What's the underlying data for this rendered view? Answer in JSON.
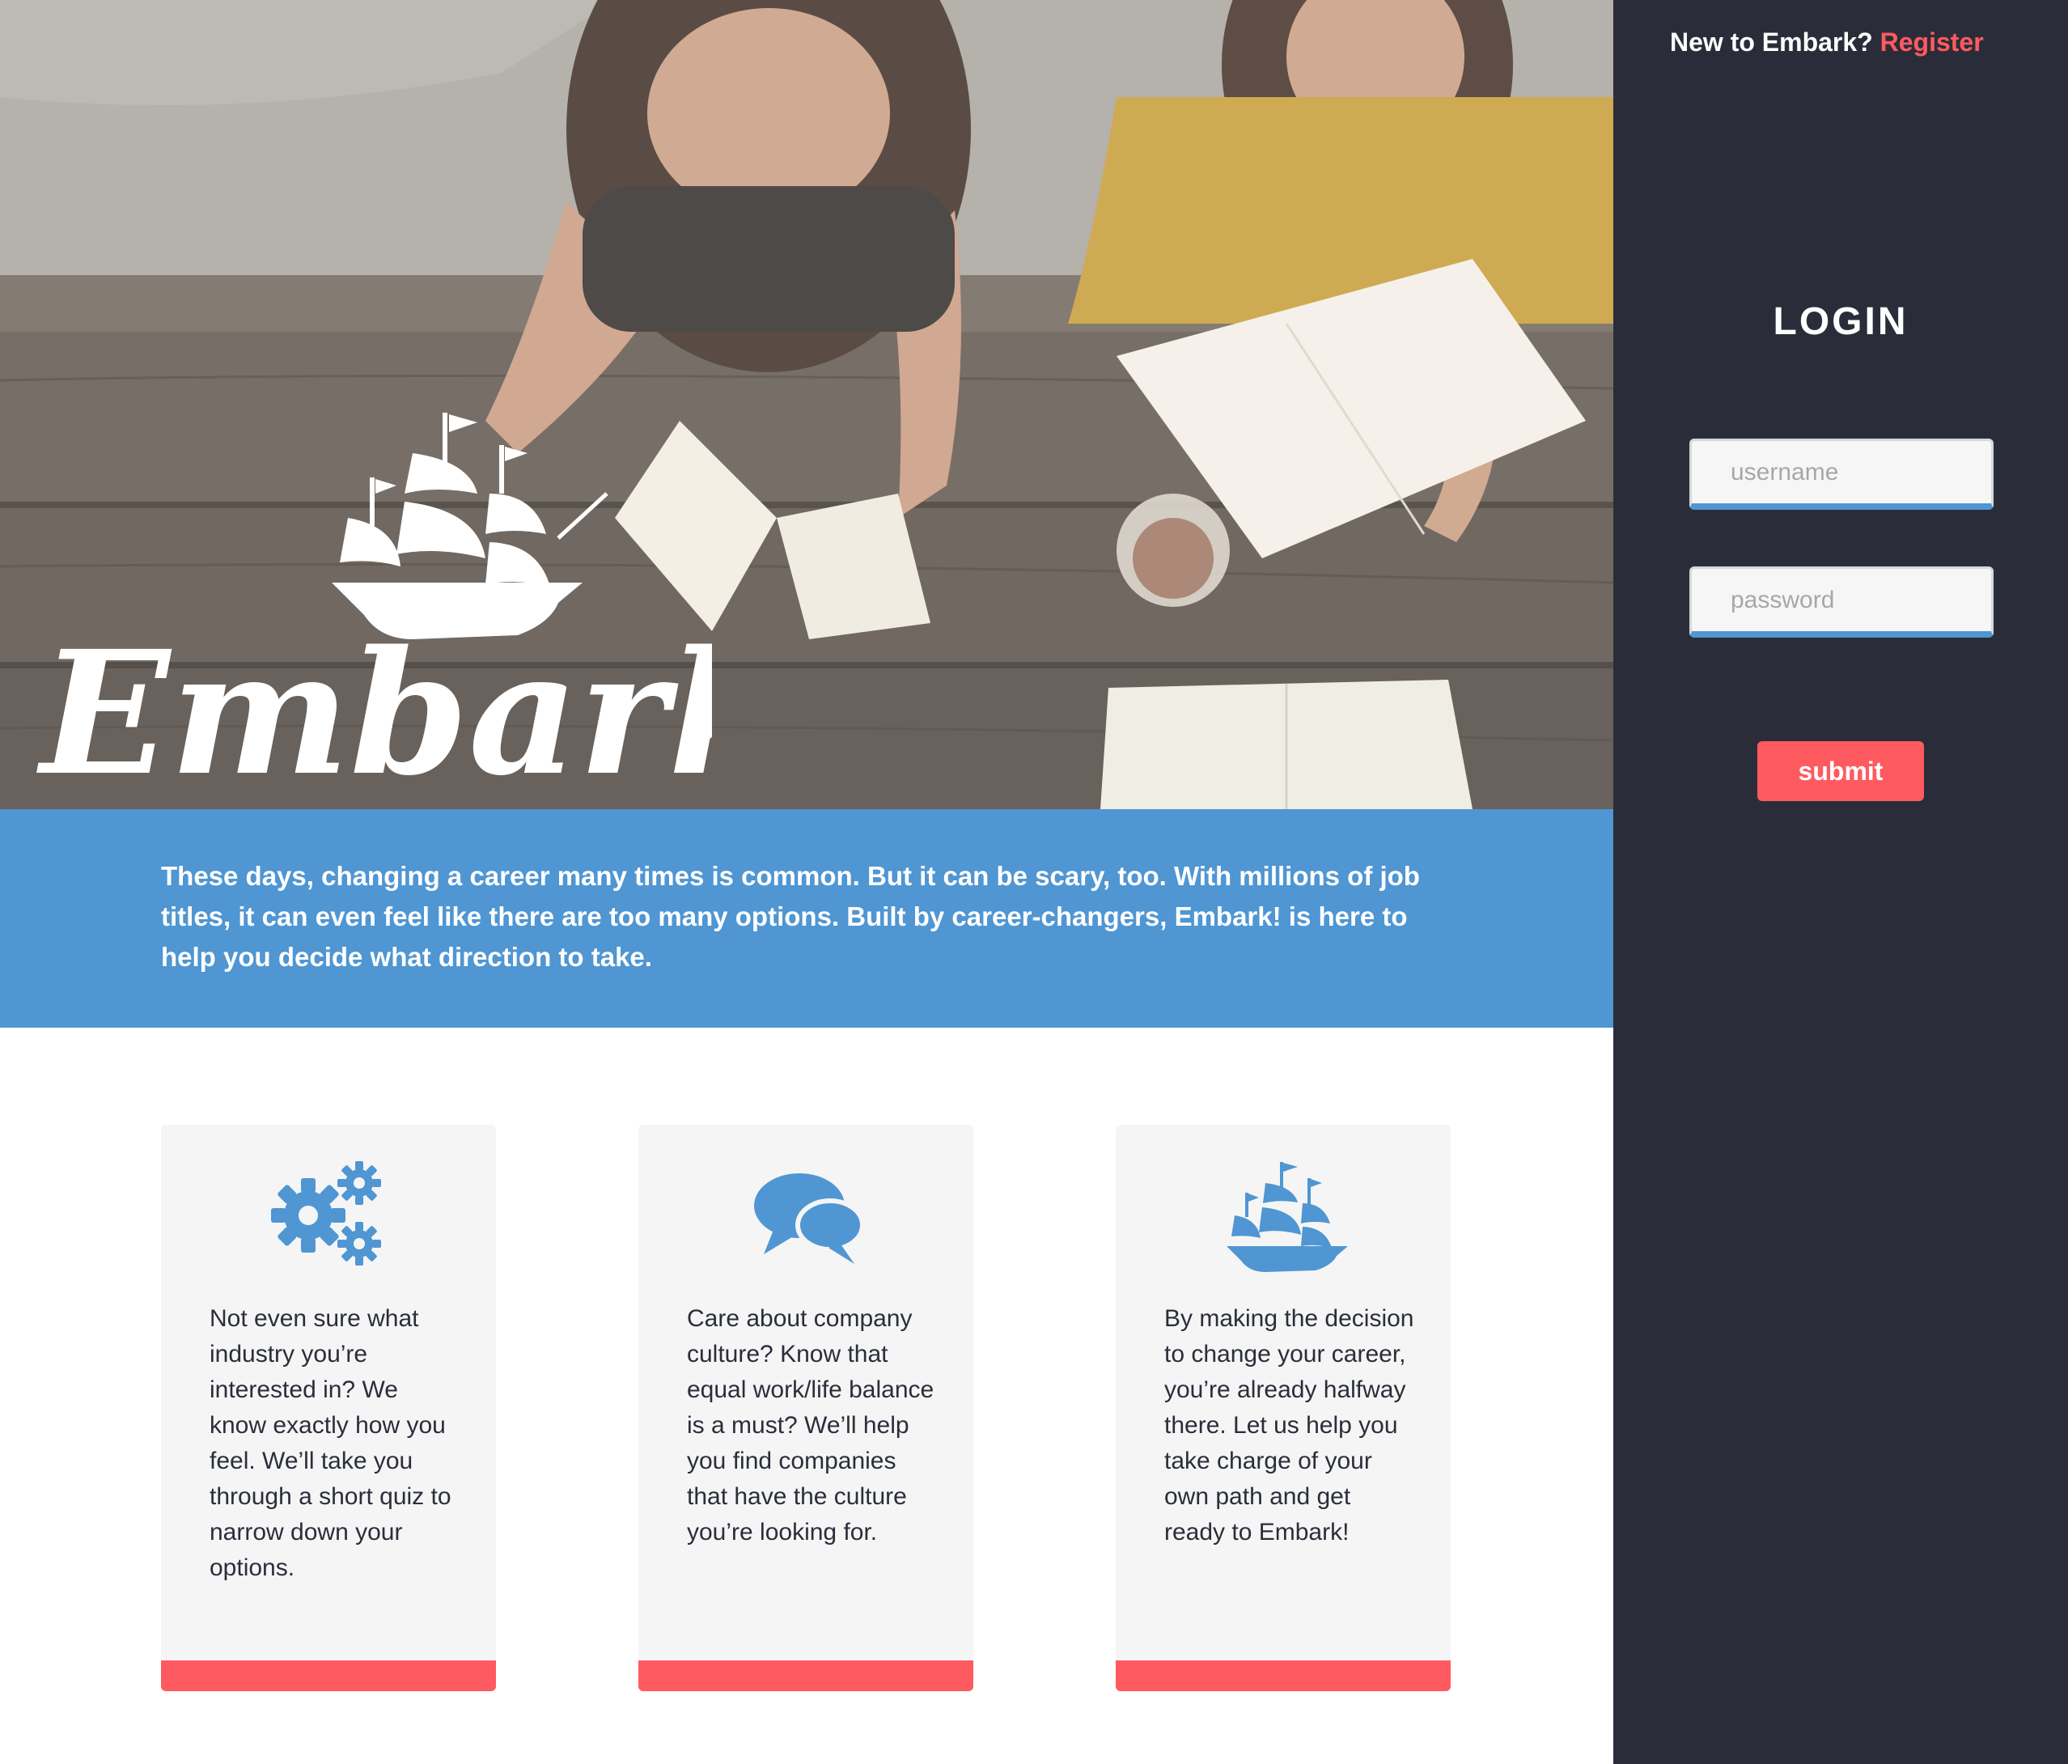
{
  "brand": {
    "logo_text": "Embark!",
    "accent_color": "#ff5a5f",
    "primary_blue": "#4f96d3",
    "sidebar_bg": "#2a2d39"
  },
  "intro": {
    "text": "These days, changing a career many times is common. But it can be scary, too. With millions of job titles, it can even feel like there are too many options. Built by career-changers, Embark! is here to help you decide what direction to take."
  },
  "features": [
    {
      "icon": "gears-icon",
      "text": "Not even sure what industry you’re interested in? We know exactly how you feel. We’ll take you through a short quiz to narrow down your options."
    },
    {
      "icon": "chat-bubbles-icon",
      "text": "Care about company culture? Know that equal work/life balance is a must? We’ll help you find companies that have the culture you’re looking for."
    },
    {
      "icon": "ship-icon",
      "text": "By making the decision to change your career, you’re already halfway there. Let us help you take charge of your own path and get ready to Embark!"
    }
  ],
  "sidebar": {
    "register_prompt": "New to Embark?",
    "register_link": "Register",
    "login_title": "LOGIN",
    "username_placeholder": "username",
    "password_placeholder": "password",
    "submit_label": "submit"
  }
}
